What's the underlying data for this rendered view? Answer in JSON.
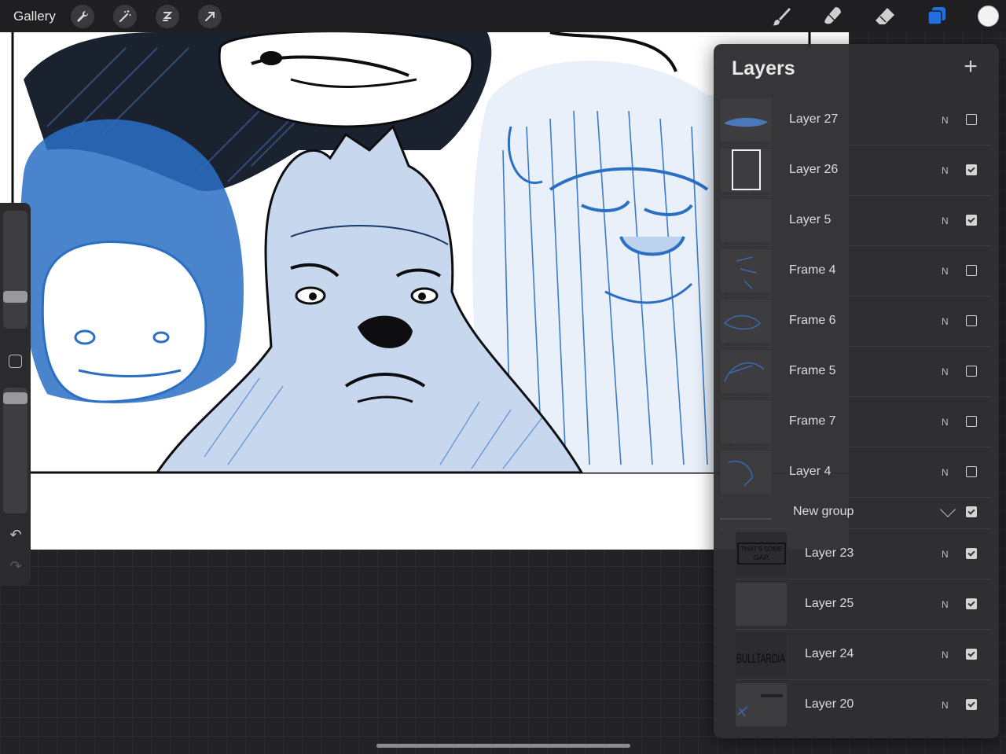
{
  "topbar": {
    "gallery_label": "Gallery",
    "left_tools": [
      "wrench-icon",
      "magic-wand-icon",
      "selection-icon",
      "transform-arrow-icon"
    ],
    "right_tools": [
      "brush-icon",
      "smudge-icon",
      "eraser-icon",
      "layers-icon"
    ],
    "active_tool_color": "#1f6fe0",
    "current_color": "#f2f2f2"
  },
  "layers_panel": {
    "title": "Layers",
    "add_icon": "+",
    "layers": [
      {
        "name": "Layer 27",
        "blend": "N",
        "visible": false
      },
      {
        "name": "Layer 26",
        "blend": "N",
        "visible": true
      },
      {
        "name": "Layer 5",
        "blend": "N",
        "visible": true
      },
      {
        "name": "Frame 4",
        "blend": "N",
        "visible": false
      },
      {
        "name": "Frame 6",
        "blend": "N",
        "visible": false
      },
      {
        "name": "Frame 5",
        "blend": "N",
        "visible": false
      },
      {
        "name": "Frame 7",
        "blend": "N",
        "visible": false
      },
      {
        "name": "Layer 4",
        "blend": "N",
        "visible": false
      }
    ],
    "group": {
      "name": "New group",
      "visible": true
    },
    "group_layers": [
      {
        "name": "Layer 23",
        "blend": "N",
        "visible": true,
        "thumb_text": "THAT'S SOME GAP."
      },
      {
        "name": "Layer 25",
        "blend": "N",
        "visible": true
      },
      {
        "name": "Layer 24",
        "blend": "N",
        "visible": true,
        "thumb_text": "BULLTARDIA"
      },
      {
        "name": "Layer 20",
        "blend": "N",
        "visible": true
      }
    ]
  },
  "sidebar": {
    "undo_icon": "↶",
    "redo_icon": "↷"
  },
  "colors": {
    "sketch_blue": "#2a6fc4",
    "ink": "#0d0d10"
  }
}
